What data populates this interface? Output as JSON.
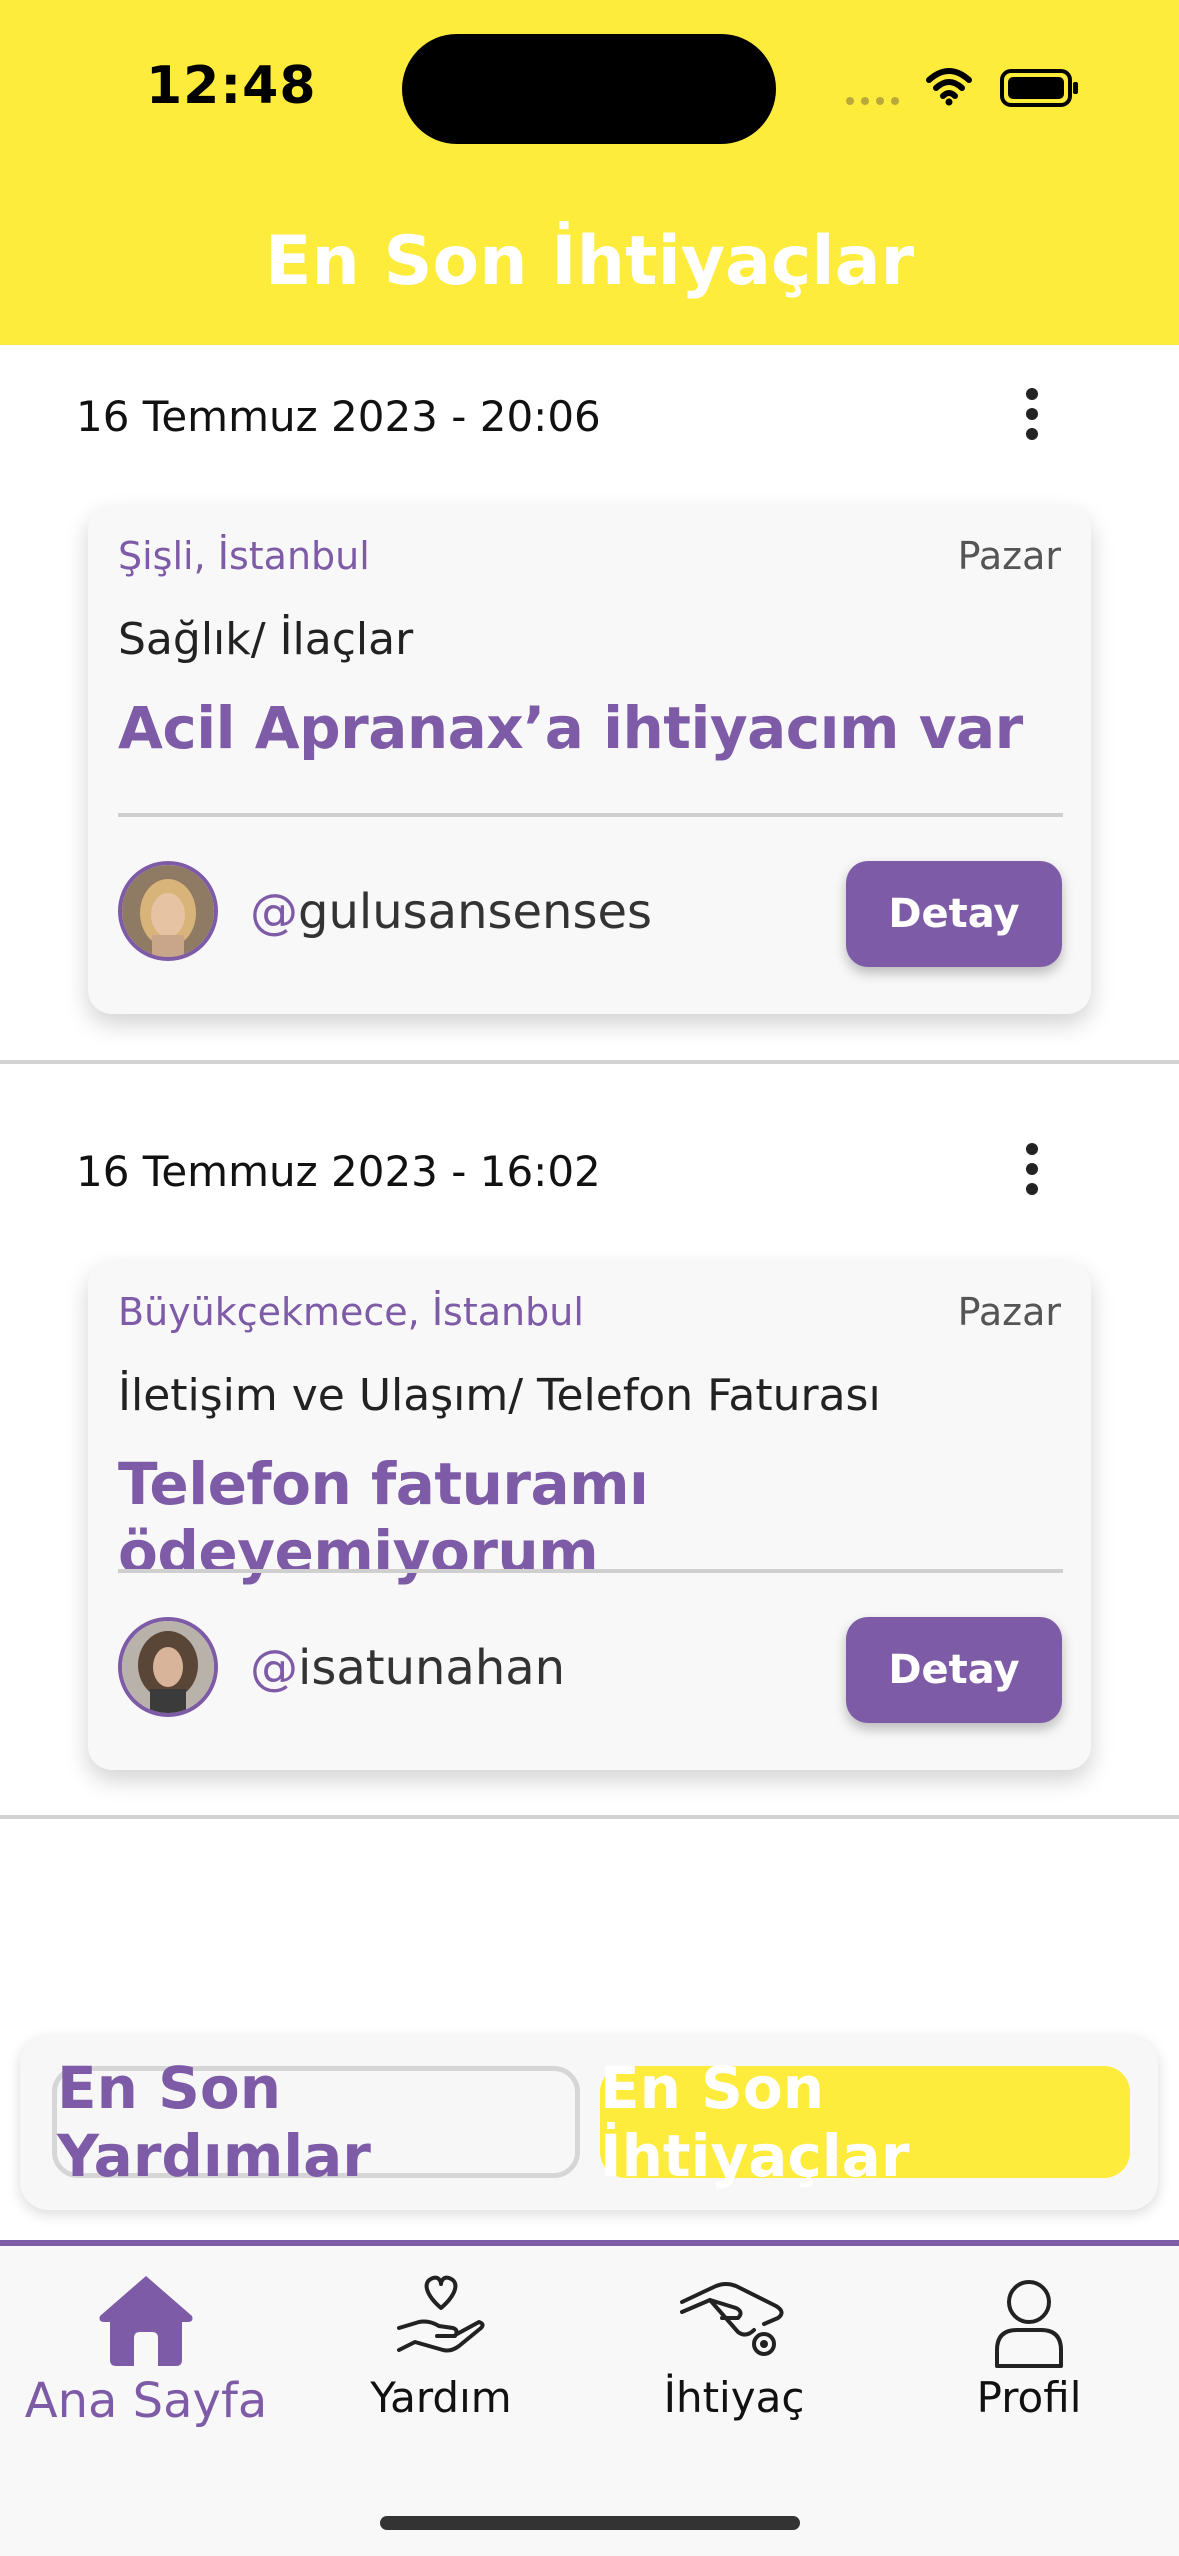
{
  "status_bar": {
    "time": "12:48"
  },
  "header": {
    "title": "En Son İhtiyaçlar"
  },
  "posts": [
    {
      "date": "16 Temmuz 2023 - 20:06",
      "location": "Şişli, İstanbul",
      "day": "Pazar",
      "category": "Sağlık/ İlaçlar",
      "title": "Acil Apranax’a ihtiyacım var",
      "username": "gulusansenses",
      "at": "@",
      "button": "Detay"
    },
    {
      "date": "16 Temmuz 2023 - 16:02",
      "location": "Büyükçekmece, İstanbul",
      "day": "Pazar",
      "category": "İletişim ve Ulaşım/ Telefon Faturası",
      "title": "Telefon faturamı ödeyemiyorum",
      "username": "isatunahan",
      "at": "@",
      "button": "Detay"
    }
  ],
  "toggle": {
    "left": "En Son Yardımlar",
    "right": "En Son İhtiyaçlar"
  },
  "nav": [
    {
      "label": "Ana Sayfa",
      "icon": "home-icon",
      "active": true
    },
    {
      "label": "Yardım",
      "icon": "heart-hand-icon",
      "active": false
    },
    {
      "label": "İhtiyaç",
      "icon": "hand-coin-icon",
      "active": false
    },
    {
      "label": "Profil",
      "icon": "person-icon",
      "active": false
    }
  ],
  "colors": {
    "accent": "#7e5ba6",
    "header": "#fdec3b"
  }
}
